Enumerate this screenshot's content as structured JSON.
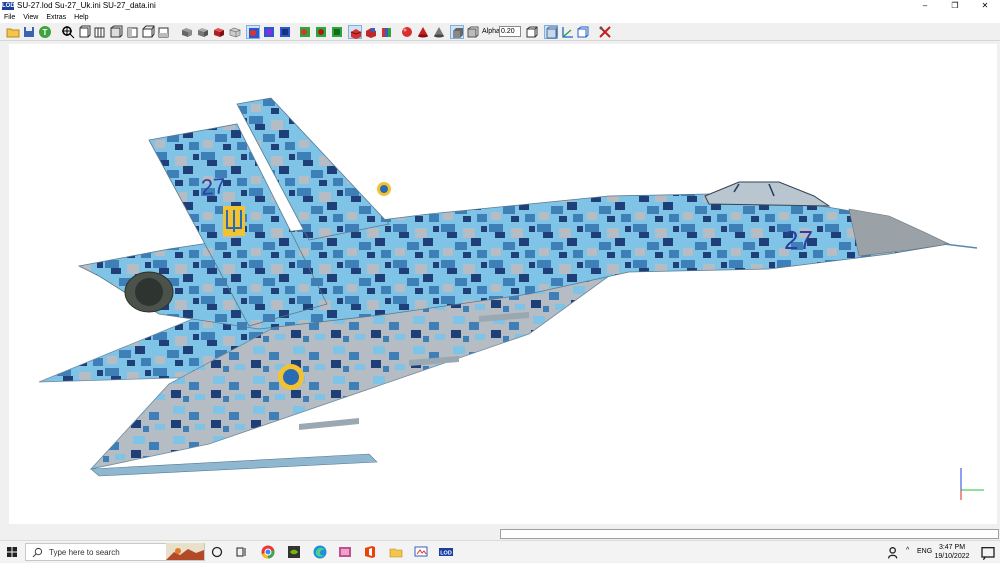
{
  "window": {
    "app_badge": "LOD",
    "title": "SU-27.lod  Su-27_Uk.ini  SU-27_data.ini",
    "minimize_glyph": "–",
    "restore_glyph": "❐",
    "close_glyph": "✕"
  },
  "menu": {
    "items": [
      "File",
      "View",
      "Extras",
      "Help"
    ]
  },
  "toolbar": {
    "alpha_label": "Alpha:",
    "alpha_value": "0.20",
    "buttons": [
      "open-folder-icon",
      "save-icon",
      "texture-icon",
      "zoom-icon",
      "view-front-icon",
      "view-back-icon",
      "view-left-icon",
      "view-right-icon",
      "view-top-icon",
      "view-bottom-icon",
      "shade-flat-icon",
      "shade-grey-icon",
      "shade-red-icon",
      "shade-wire-icon",
      "select-blue-1-icon",
      "select-blue-2-icon",
      "select-blue-3-icon",
      "select-green-1-icon",
      "select-green-2-icon",
      "select-green-3-icon",
      "mesh-red-icon",
      "mesh-red-2-icon",
      "mesh-multi-icon",
      "sphere-red-icon",
      "cone-red-icon",
      "object-grey-icon",
      "box-grey-icon",
      "box-outline-icon",
      "cube-outline-icon",
      "axes-icon",
      "grid-icon",
      "tools-icon"
    ]
  },
  "model": {
    "tail_number": "27",
    "nose_number": "27",
    "colors": {
      "camo_light_blue": "#7fc3e6",
      "camo_mid_blue": "#3f7fb8",
      "camo_dark_blue": "#1f3f78",
      "camo_grey": "#b5bcc3",
      "radome": "#9aa2a8",
      "roundel_yellow": "#f2c230",
      "roundel_blue": "#2a6bb5"
    }
  },
  "taskbar": {
    "search_placeholder": "Type here to search",
    "language": "ENG",
    "time": "3:47 PM",
    "date": "19/10/2022",
    "apps": [
      "task-view-icon",
      "cortana-icon",
      "chrome-icon",
      "nvidia-icon",
      "edge-icon",
      "photos-icon",
      "office-icon",
      "file-explorer-icon",
      "paint-icon",
      "lod-viewer-icon"
    ]
  }
}
